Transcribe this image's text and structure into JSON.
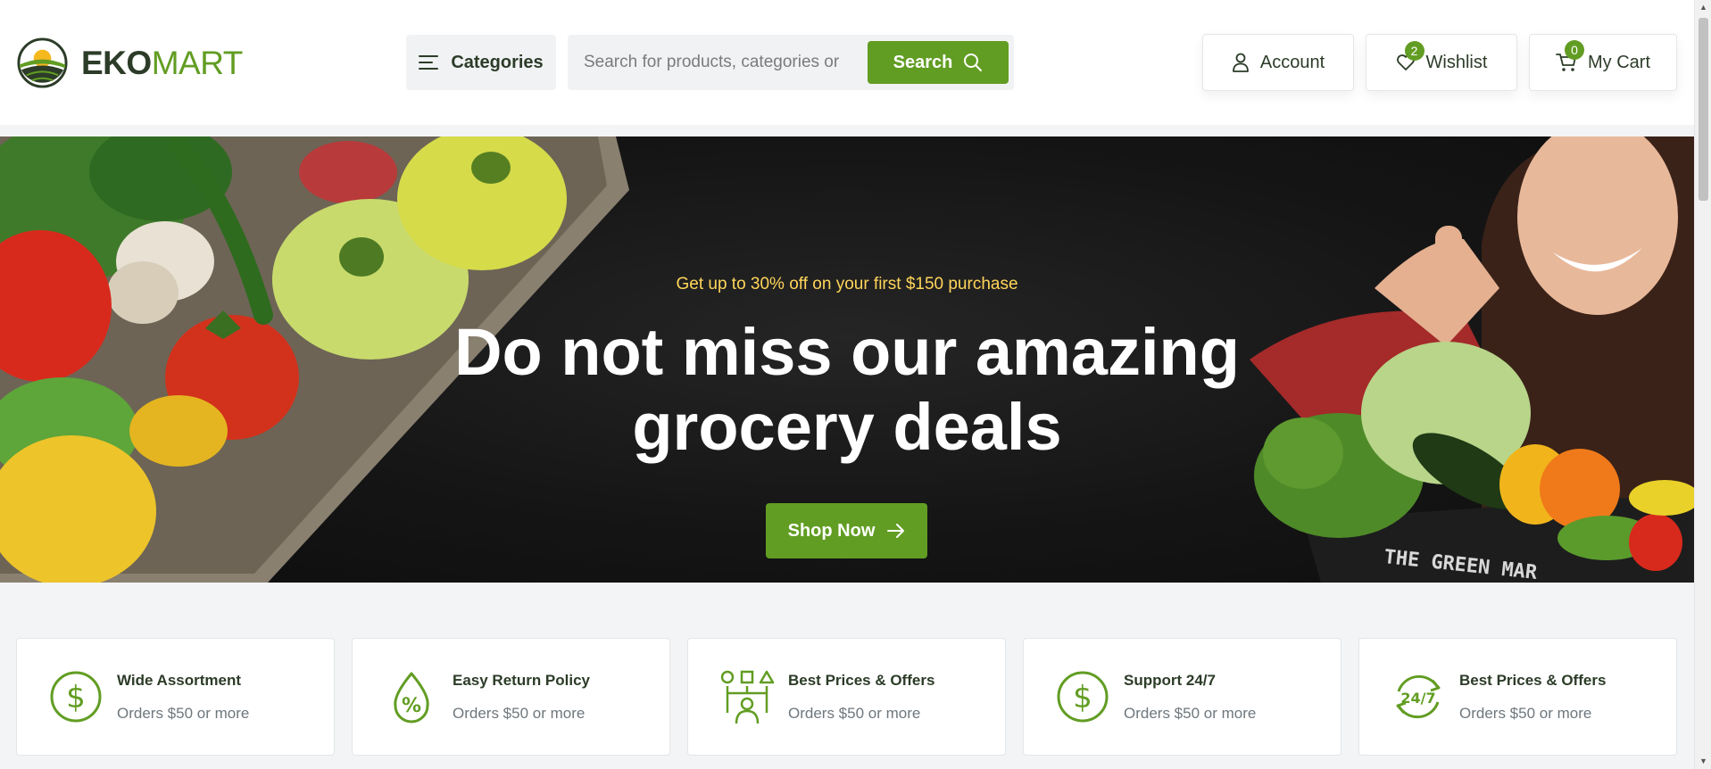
{
  "brand": {
    "name_bold": "EKO",
    "name_light": "MART"
  },
  "header": {
    "categories_label": "Categories",
    "search_placeholder": "Search for products, categories or",
    "search_button": "Search",
    "account_label": "Account",
    "wishlist_label": "Wishlist",
    "wishlist_count": "2",
    "cart_label": "My Cart",
    "cart_count": "0"
  },
  "hero": {
    "subtitle": "Get up to 30% off on your first $150 purchase",
    "title": "Do not miss our amazing grocery deals",
    "cta": "Shop Now",
    "crate_text": "THE GREEN MAR"
  },
  "features": [
    {
      "title": "Wide Assortment",
      "subtitle": "Orders $50 or more",
      "icon": "dollar-circle-icon"
    },
    {
      "title": "Easy Return Policy",
      "subtitle": "Orders $50 or more",
      "icon": "percent-drop-icon"
    },
    {
      "title": "Best Prices & Offers",
      "subtitle": "Orders $50 or more",
      "icon": "options-person-icon"
    },
    {
      "title": "Support 24/7",
      "subtitle": "Orders $50 or more",
      "icon": "dollar-circle-icon"
    },
    {
      "title": "Best Prices & Offers",
      "subtitle": "Orders $50 or more",
      "icon": "support-24-7-icon"
    }
  ],
  "colors": {
    "brand_green": "#629d23",
    "dark_text": "#2c3c28",
    "hero_subtitle": "#ffd55a",
    "hero_bg": "#151515"
  }
}
